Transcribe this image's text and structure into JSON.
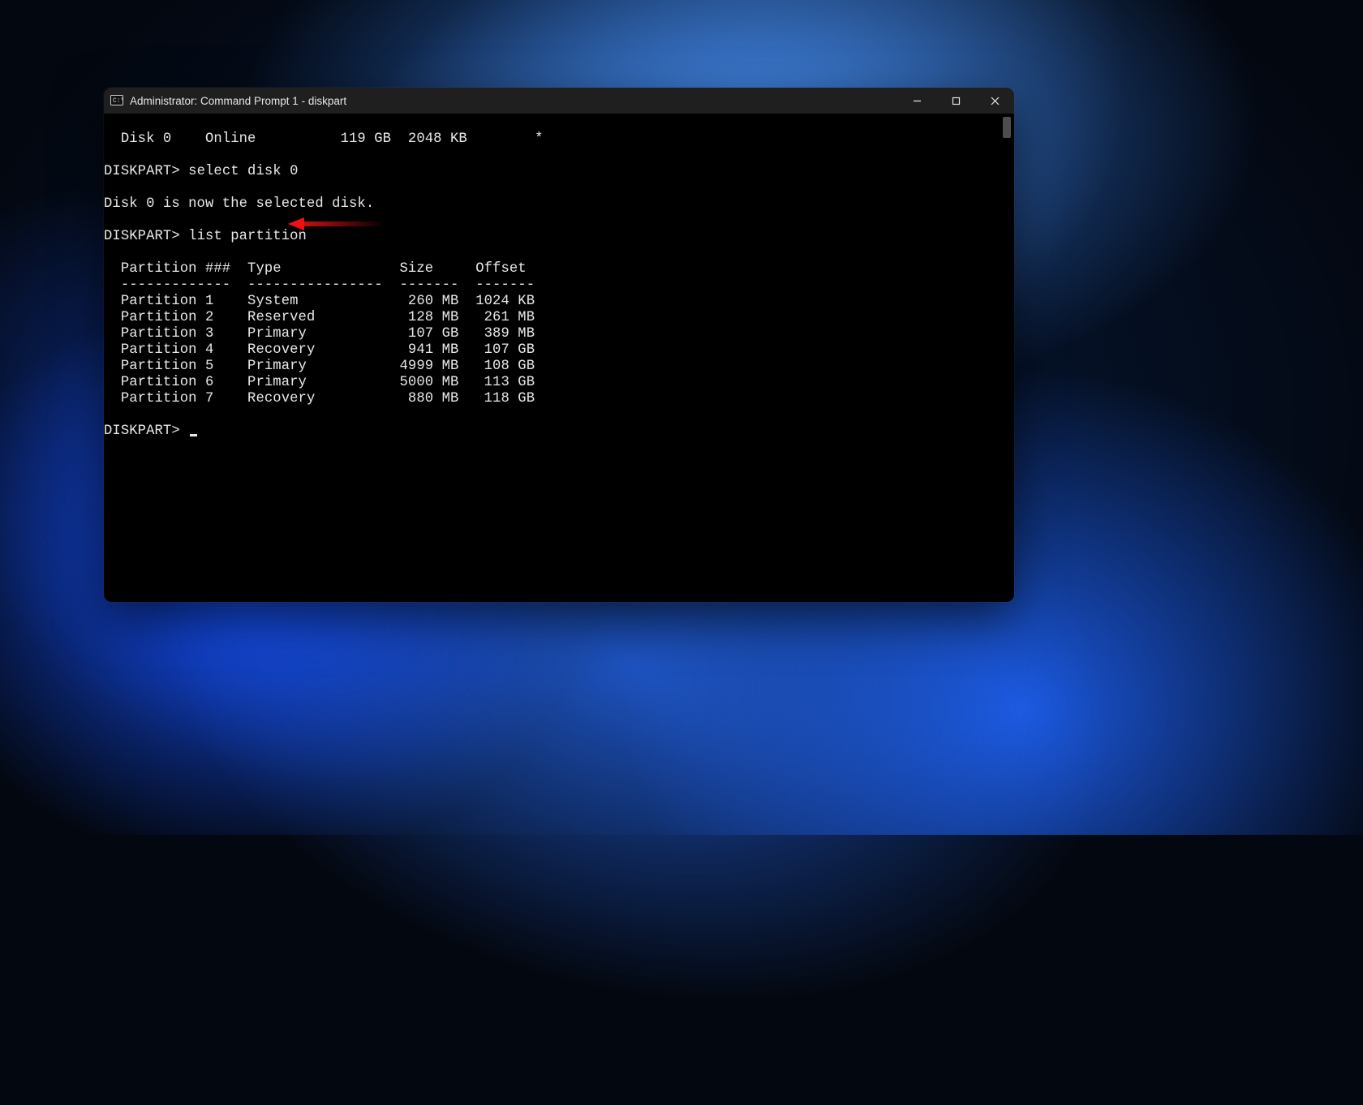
{
  "window": {
    "title": "Administrator: Command Prompt 1 - diskpart"
  },
  "terminal": {
    "prompt": "DISKPART>",
    "disk_row": "  Disk 0    Online          119 GB  2048 KB        *",
    "cmd_select_disk": "select disk 0",
    "msg_selected": "Disk 0 is now the selected disk.",
    "cmd_list_partition": "list partition",
    "partition_table": {
      "header": "  Partition ###  Type              Size     Offset",
      "divider": "  -------------  ----------------  -------  -------",
      "rows": [
        "  Partition 1    System             260 MB  1024 KB",
        "  Partition 2    Reserved           128 MB   261 MB",
        "  Partition 3    Primary            107 GB   389 MB",
        "  Partition 4    Recovery           941 MB   107 GB",
        "  Partition 5    Primary           4999 MB   108 GB",
        "  Partition 6    Primary           5000 MB   113 GB",
        "  Partition 7    Recovery           880 MB   118 GB"
      ]
    }
  },
  "annotation": {
    "arrow_color": "#e11"
  }
}
